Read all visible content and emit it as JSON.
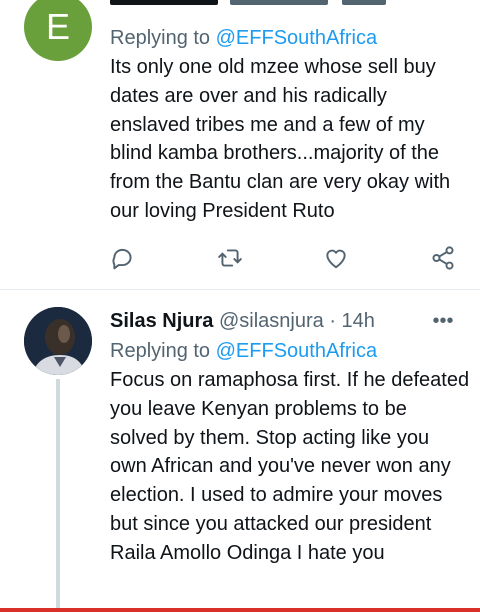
{
  "tweet1": {
    "avatar_letter": "E",
    "replying_prefix": "Replying to",
    "replying_handle": "@EFFSouthAfrica",
    "text": "Its only one old mzee whose sell buy dates are over and his radically enslaved tribes me and a few of my blind kamba brothers...majority of the from the Bantu clan are very okay with our loving President Ruto",
    "actions": [
      "reply-icon",
      "retweet-icon",
      "like-icon",
      "share-icon"
    ]
  },
  "tweet2": {
    "name": "Silas Njura",
    "handle": "@silasnjura",
    "separator": "·",
    "time": "14h",
    "more": "•••",
    "replying_prefix": "Replying to",
    "replying_handle": "@EFFSouthAfrica",
    "text": "Focus on ramaphosa first. If he defeated you leave Kenyan problems to be solved by them. Stop acting like you own African and you've never won any election. I used to admire your moves but since you attacked our president Raila Amollo Odinga I hate you"
  },
  "colors": {
    "accent": "#1d9bf0",
    "muted": "#536471",
    "avatar_green": "#6aa03c",
    "bottom_bar": "#d9302a"
  }
}
